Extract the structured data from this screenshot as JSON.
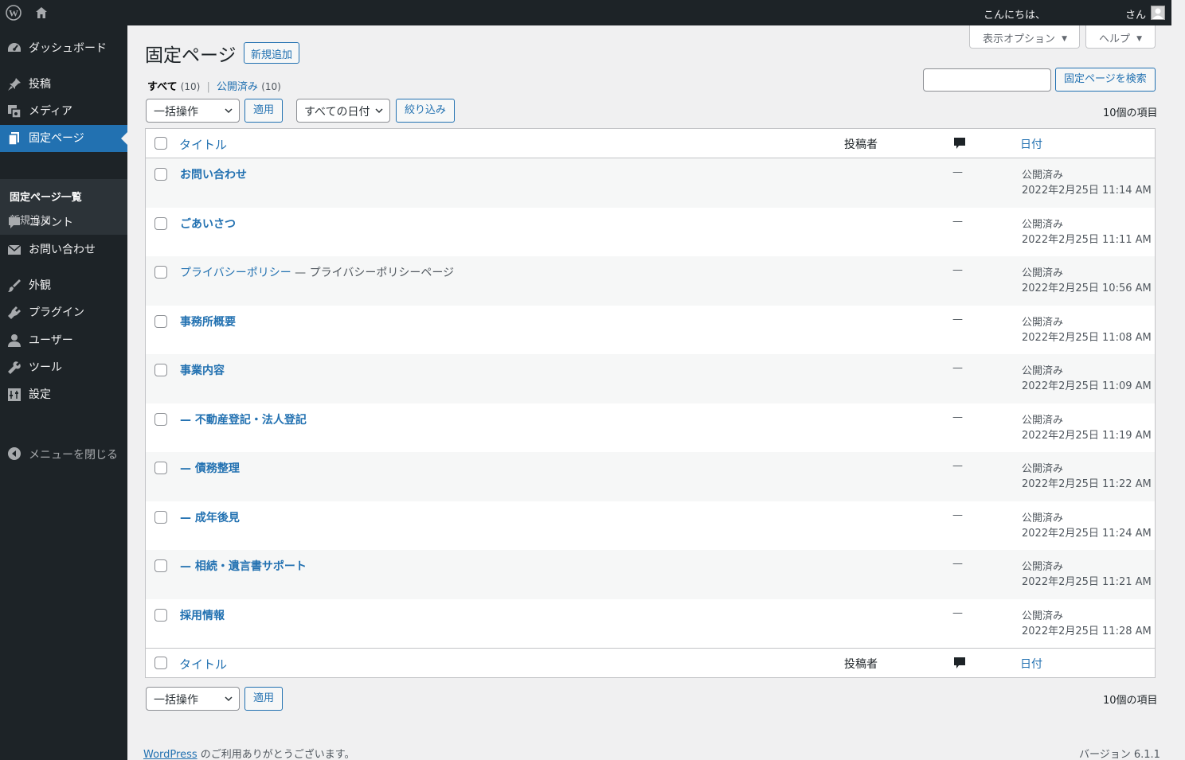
{
  "adminbar": {
    "greeting": "こんにちは、",
    "user_suffix": "さん"
  },
  "sidebar": {
    "items": [
      {
        "label": "ダッシュボード",
        "icon": "dashboard-icon"
      },
      {
        "label": "投稿",
        "icon": "pin-icon"
      },
      {
        "label": "メディア",
        "icon": "media-icon"
      },
      {
        "label": "固定ページ",
        "icon": "page-icon"
      },
      {
        "label": "コメント",
        "icon": "comment-icon"
      },
      {
        "label": "お問い合わせ",
        "icon": "mail-icon"
      },
      {
        "label": "外観",
        "icon": "brush-icon"
      },
      {
        "label": "プラグイン",
        "icon": "plugin-icon"
      },
      {
        "label": "ユーザー",
        "icon": "user-icon"
      },
      {
        "label": "ツール",
        "icon": "wrench-icon"
      },
      {
        "label": "設定",
        "icon": "settings-icon"
      }
    ],
    "submenu": [
      "固定ページ一覧",
      "新規追加"
    ],
    "collapse": "メニューを閉じる"
  },
  "screen_options": {
    "options": "表示オプション",
    "help": "ヘルプ"
  },
  "header": {
    "title": "固定ページ",
    "add_new": "新規追加"
  },
  "views": {
    "all_label": "すべて",
    "all_count": "(10)",
    "separator": "|",
    "published_label": "公開済み",
    "published_count": "(10)"
  },
  "search": {
    "value": "",
    "button": "固定ページを検索"
  },
  "tablenav": {
    "bulk_action": "一括操作",
    "apply": "適用",
    "date_filter": "すべての日付",
    "filter": "絞り込み",
    "item_count": "10個の項目"
  },
  "table": {
    "columns": {
      "title": "タイトル",
      "author": "投稿者",
      "date": "日付"
    },
    "rows": [
      {
        "title": "お問い合わせ",
        "state": "",
        "comments": "—",
        "status": "公開済み",
        "date": "2022年2月25日 11:14 AM"
      },
      {
        "title": "ごあいさつ",
        "state": "",
        "comments": "—",
        "status": "公開済み",
        "date": "2022年2月25日 11:11 AM"
      },
      {
        "title": "プライバシーポリシー",
        "state": " — プライバシーポリシーページ",
        "comments": "—",
        "status": "公開済み",
        "date": "2022年2月25日 10:56 AM"
      },
      {
        "title": "事務所概要",
        "state": "",
        "comments": "—",
        "status": "公開済み",
        "date": "2022年2月25日 11:08 AM"
      },
      {
        "title": "事業内容",
        "state": "",
        "comments": "—",
        "status": "公開済み",
        "date": "2022年2月25日 11:09 AM"
      },
      {
        "title": "— 不動産登記・法人登記",
        "state": "",
        "comments": "—",
        "status": "公開済み",
        "date": "2022年2月25日 11:19 AM"
      },
      {
        "title": "— 債務整理",
        "state": "",
        "comments": "—",
        "status": "公開済み",
        "date": "2022年2月25日 11:22 AM"
      },
      {
        "title": "— 成年後見",
        "state": "",
        "comments": "—",
        "status": "公開済み",
        "date": "2022年2月25日 11:24 AM"
      },
      {
        "title": "— 相続・遺言書サポート",
        "state": "",
        "comments": "—",
        "status": "公開済み",
        "date": "2022年2月25日 11:21 AM"
      },
      {
        "title": "採用情報",
        "state": "",
        "comments": "—",
        "status": "公開済み",
        "date": "2022年2月25日 11:28 AM"
      }
    ]
  },
  "footer": {
    "link": "WordPress",
    "thanks": " のご利用ありがとうございます。",
    "version": "バージョン 6.1.1"
  }
}
